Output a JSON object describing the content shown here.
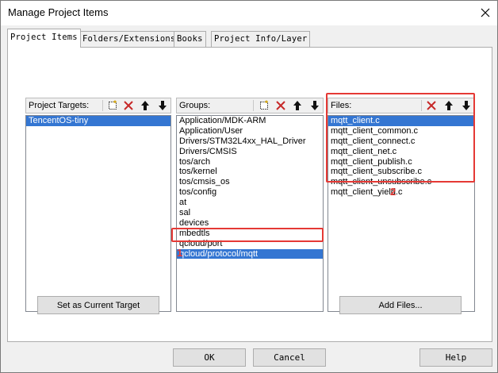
{
  "window": {
    "title": "Manage Project Items",
    "close_glyph": "close-icon"
  },
  "tabs": [
    {
      "label": "Project Items",
      "active": true
    },
    {
      "label": "Folders/Extensions",
      "active": false
    },
    {
      "label": "Books",
      "active": false
    },
    {
      "label": "Project Info/Layer",
      "active": false
    }
  ],
  "targets": {
    "header": "Project Targets:",
    "items": [
      "TencentOS-tiny"
    ],
    "selected_index": 0,
    "button": "Set as Current Target"
  },
  "groups": {
    "header": "Groups:",
    "items": [
      "Application/MDK-ARM",
      "Application/User",
      "Drivers/STM32L4xx_HAL_Driver",
      "Drivers/CMSIS",
      "tos/arch",
      "tos/kernel",
      "tos/cmsis_os",
      "tos/config",
      "at",
      "sal",
      "devices",
      "mbedtls",
      "qcloud/port",
      "qcloud/protocol/mqtt"
    ],
    "selected_index": 13
  },
  "files": {
    "header": "Files:",
    "items": [
      "mqtt_client.c",
      "mqtt_client_common.c",
      "mqtt_client_connect.c",
      "mqtt_client_net.c",
      "mqtt_client_publish.c",
      "mqtt_client_subscribe.c",
      "mqtt_client_unsubscribe.c",
      "mqtt_client_yield.c"
    ],
    "selected_index": 0,
    "button": "Add Files..."
  },
  "annotations": {
    "callout_1": "1",
    "callout_2": "2"
  },
  "footer": {
    "ok": "OK",
    "cancel": "Cancel",
    "help": "Help"
  },
  "colors": {
    "selection": "#3476d2",
    "highlight": "#e53935",
    "delete_icon": "#c62828"
  }
}
